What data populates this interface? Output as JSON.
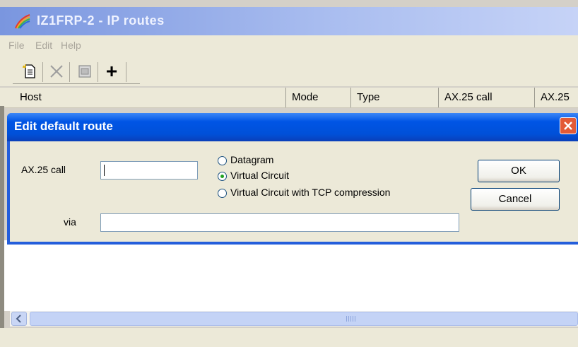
{
  "main_window": {
    "title": "IZ1FRP-2 - IP routes",
    "menu": [
      "File",
      "Edit",
      "Help"
    ],
    "toolbar": {
      "buttons": [
        {
          "name": "new-document-icon"
        },
        {
          "name": "delete-x-icon"
        },
        {
          "name": "properties-icon"
        },
        {
          "name": "add-plus-icon",
          "glyph": "+"
        }
      ]
    },
    "columns": [
      "Host",
      "Mode",
      "Type",
      "AX.25 call",
      "AX.25"
    ]
  },
  "dialog": {
    "title": "Edit default route",
    "ax25_call_label": "AX.25 call",
    "ax25_call_value": "",
    "via_label": "via",
    "via_value": "",
    "mode_options": [
      {
        "label": "Datagram",
        "selected": false
      },
      {
        "label": "Virtual Circuit",
        "selected": true
      },
      {
        "label": "Virtual Circuit with TCP compression",
        "selected": false
      }
    ],
    "ok_label": "OK",
    "cancel_label": "Cancel"
  },
  "colors": {
    "dialog_title": "#0055e5",
    "window_body": "#ece9d8",
    "close_button": "#e35a36"
  }
}
